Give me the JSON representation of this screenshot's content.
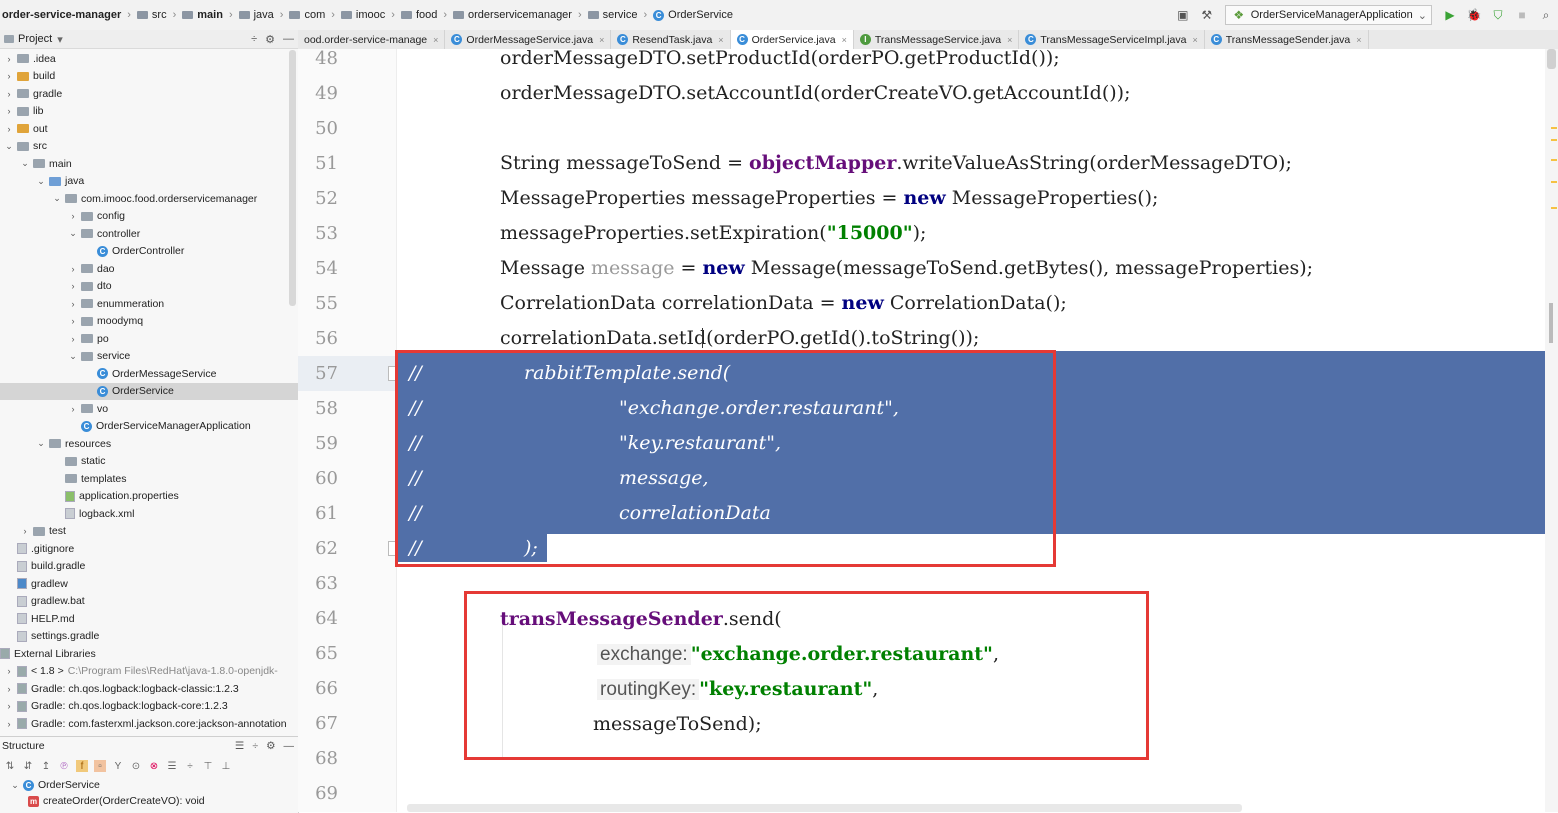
{
  "navbar": {
    "crumbs": [
      {
        "label": "order-service-manager",
        "icon": "none",
        "bold": true
      },
      {
        "label": "src",
        "icon": "folder-icon"
      },
      {
        "label": "main",
        "icon": "folder-icon",
        "bold": true
      },
      {
        "label": "java",
        "icon": "folder-icon"
      },
      {
        "label": "com",
        "icon": "folder-icon"
      },
      {
        "label": "imooc",
        "icon": "folder-icon"
      },
      {
        "label": "food",
        "icon": "folder-icon"
      },
      {
        "label": "orderservicemanager",
        "icon": "folder-icon"
      },
      {
        "label": "service",
        "icon": "folder-icon"
      },
      {
        "label": "OrderService",
        "icon": "class-icon"
      }
    ],
    "run_config": "OrderServiceManagerApplication"
  },
  "project_panel": {
    "title": "Project",
    "tree": [
      {
        "label": ".idea",
        "depth": 0,
        "arrow": ">",
        "kind": "folder"
      },
      {
        "label": "build",
        "depth": 0,
        "arrow": ">",
        "kind": "folder-orange"
      },
      {
        "label": "gradle",
        "depth": 0,
        "arrow": ">",
        "kind": "folder"
      },
      {
        "label": "lib",
        "depth": 0,
        "arrow": ">",
        "kind": "folder"
      },
      {
        "label": "out",
        "depth": 0,
        "arrow": ">",
        "kind": "folder-orange"
      },
      {
        "label": "src",
        "depth": 0,
        "arrow": "v",
        "kind": "folder"
      },
      {
        "label": "main",
        "depth": 1,
        "arrow": "v",
        "kind": "folder"
      },
      {
        "label": "java",
        "depth": 2,
        "arrow": "v",
        "kind": "folder-blue"
      },
      {
        "label": "com.imooc.food.orderservicemanager",
        "depth": 3,
        "arrow": "v",
        "kind": "folder"
      },
      {
        "label": "config",
        "depth": 4,
        "arrow": ">",
        "kind": "folder"
      },
      {
        "label": "controller",
        "depth": 4,
        "arrow": "v",
        "kind": "folder"
      },
      {
        "label": "OrderController",
        "depth": 5,
        "arrow": "",
        "kind": "class"
      },
      {
        "label": "dao",
        "depth": 4,
        "arrow": ">",
        "kind": "folder"
      },
      {
        "label": "dto",
        "depth": 4,
        "arrow": ">",
        "kind": "folder"
      },
      {
        "label": "enummeration",
        "depth": 4,
        "arrow": ">",
        "kind": "folder"
      },
      {
        "label": "moodymq",
        "depth": 4,
        "arrow": ">",
        "kind": "folder"
      },
      {
        "label": "po",
        "depth": 4,
        "arrow": ">",
        "kind": "folder"
      },
      {
        "label": "service",
        "depth": 4,
        "arrow": "v",
        "kind": "folder"
      },
      {
        "label": "OrderMessageService",
        "depth": 5,
        "arrow": "",
        "kind": "class"
      },
      {
        "label": "OrderService",
        "depth": 5,
        "arrow": "",
        "kind": "class",
        "selected": true
      },
      {
        "label": "vo",
        "depth": 4,
        "arrow": ">",
        "kind": "folder"
      },
      {
        "label": "OrderServiceManagerApplication",
        "depth": 4,
        "arrow": "",
        "kind": "class"
      },
      {
        "label": "resources",
        "depth": 2,
        "arrow": "v",
        "kind": "folder"
      },
      {
        "label": "static",
        "depth": 3,
        "arrow": "",
        "kind": "folder"
      },
      {
        "label": "templates",
        "depth": 3,
        "arrow": "",
        "kind": "folder"
      },
      {
        "label": "application.properties",
        "depth": 3,
        "arrow": "",
        "kind": "file-green"
      },
      {
        "label": "logback.xml",
        "depth": 3,
        "arrow": "",
        "kind": "file"
      },
      {
        "label": "test",
        "depth": 1,
        "arrow": ">",
        "kind": "folder"
      },
      {
        "label": ".gitignore",
        "depth": 0,
        "arrow": "",
        "kind": "file"
      },
      {
        "label": "build.gradle",
        "depth": 0,
        "arrow": "",
        "kind": "file"
      },
      {
        "label": "gradlew",
        "depth": 0,
        "arrow": "",
        "kind": "file-blue"
      },
      {
        "label": "gradlew.bat",
        "depth": 0,
        "arrow": "",
        "kind": "file"
      },
      {
        "label": "HELP.md",
        "depth": 0,
        "arrow": "",
        "kind": "file"
      },
      {
        "label": "settings.gradle",
        "depth": 0,
        "arrow": "",
        "kind": "file"
      },
      {
        "label": "External Libraries",
        "depth": -1,
        "arrow": "",
        "kind": "lib"
      },
      {
        "label": "< 1.8 >",
        "depth": 0,
        "arrow": ">",
        "kind": "lib",
        "muted": "C:\\Program Files\\RedHat\\java-1.8.0-openjdk-"
      },
      {
        "label": "Gradle: ch.qos.logback:logback-classic:1.2.3",
        "depth": 0,
        "arrow": ">",
        "kind": "lib"
      },
      {
        "label": "Gradle: ch.qos.logback:logback-core:1.2.3",
        "depth": 0,
        "arrow": ">",
        "kind": "lib"
      },
      {
        "label": "Gradle: com.fasterxml.jackson.core:jackson-annotation",
        "depth": 0,
        "arrow": ">",
        "kind": "lib"
      }
    ]
  },
  "structure_panel": {
    "title": "Structure",
    "class_name": "OrderService",
    "method": "createOrder(OrderCreateVO): void"
  },
  "tabs": [
    {
      "label": "ood.order-service-manage",
      "icon": "none"
    },
    {
      "label": "OrderMessageService.java",
      "icon": "C"
    },
    {
      "label": "ResendTask.java",
      "icon": "C"
    },
    {
      "label": "OrderService.java",
      "icon": "C",
      "active": true
    },
    {
      "label": "TransMessageService.java",
      "icon": "I"
    },
    {
      "label": "TransMessageServiceImpl.java",
      "icon": "C"
    },
    {
      "label": "TransMessageSender.java",
      "icon": "C"
    }
  ],
  "editor": {
    "line_numbers": [
      "48",
      "49",
      "50",
      "51",
      "52",
      "53",
      "54",
      "55",
      "56",
      "57",
      "58",
      "59",
      "60",
      "61",
      "62",
      "63",
      "64",
      "65",
      "66",
      "67",
      "68",
      "69"
    ],
    "lines": {
      "l48": "orderMessageDTO.setProductId(orderPO.getProductId());",
      "l49": "orderMessageDTO.setAccountId(orderCreateVO.getAccountId());",
      "l51a": "String messageToSend = ",
      "l51b": "objectMapper",
      "l51c": ".writeValueAsString(orderMessageDTO);",
      "l52a": "MessageProperties messageProperties = ",
      "l52b": "new",
      "l52c": " MessageProperties();",
      "l53a": "messageProperties.setExpiration(",
      "l53b": "\"15000\"",
      "l53c": ");",
      "l54a": "Message ",
      "l54b": "message",
      "l54c": " = ",
      "l54d": "new",
      "l54e": " Message(messageToSend.getBytes(), messageProperties);",
      "l55a": "CorrelationData correlationData = ",
      "l55b": "new",
      "l55c": " CorrelationData();",
      "l56": "correlationData.setId(orderPO.getId().toString());",
      "l57": "rabbitTemplate.send(",
      "l58": "\"exchange.order.restaurant\",",
      "l59": "\"key.restaurant\",",
      "l60": "message,",
      "l61": "correlationData",
      "l62": ");",
      "comment_prefix": "//",
      "l64a": "transMessageSender",
      "l64b": ".send(",
      "l65_hint": "exchange:",
      "l65_str": "\"exchange.order.restaurant\"",
      "l65_tail": ",",
      "l66_hint": "routingKey:",
      "l66_str": "\"key.restaurant\"",
      "l66_tail": ",",
      "l67": "messageToSend);"
    }
  },
  "colors": {
    "selection": "#516fa8",
    "highlight_box": "#e53935",
    "keyword": "#000080",
    "string": "#008000",
    "field": "#660e7a"
  }
}
